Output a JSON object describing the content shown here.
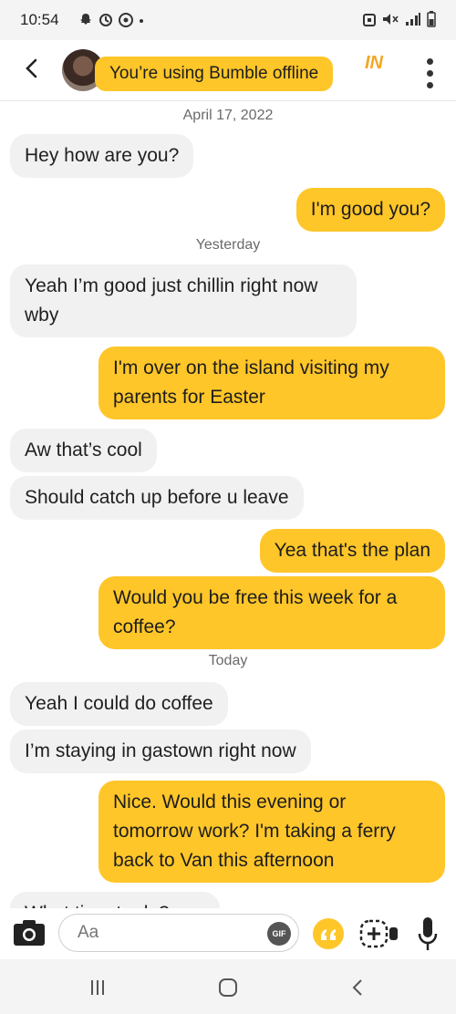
{
  "status_bar": {
    "time": "10:54"
  },
  "header": {
    "offline_banner": "You’re using Bumble offline",
    "badge": "IN"
  },
  "messages": [
    {
      "kind": "date",
      "text": "April 17, 2022"
    },
    {
      "kind": "incoming",
      "text": "Hey how are you?"
    },
    {
      "kind": "outgoing",
      "text": "I'm good you?"
    },
    {
      "kind": "date",
      "text": "Yesterday"
    },
    {
      "kind": "incoming",
      "text": "Yeah I’m good just chillin right now wby"
    },
    {
      "kind": "outgoing",
      "text": "I'm over on the island visiting my parents for Easter"
    },
    {
      "kind": "incoming",
      "text": "Aw that’s cool"
    },
    {
      "kind": "incoming",
      "text": "Should catch up before u leave"
    },
    {
      "kind": "outgoing",
      "text": "Yea that's the plan"
    },
    {
      "kind": "outgoing",
      "text": "Would you be free this week for a coffee?"
    },
    {
      "kind": "date",
      "text": "Today"
    },
    {
      "kind": "incoming",
      "text": "Yeah I could do coffee"
    },
    {
      "kind": "incoming",
      "text": "I’m staying in gastown right now"
    },
    {
      "kind": "outgoing",
      "text": "Nice. Would this evening or tomorrow work? I'm taking a ferry back to Van this afternoon"
    },
    {
      "kind": "incoming",
      "text": "What time to do?"
    }
  ],
  "composer": {
    "placeholder": "Aa",
    "gif_label": "GIF"
  },
  "colors": {
    "accent": "#ffc629",
    "incoming_bubble": "#f1f1f1"
  }
}
